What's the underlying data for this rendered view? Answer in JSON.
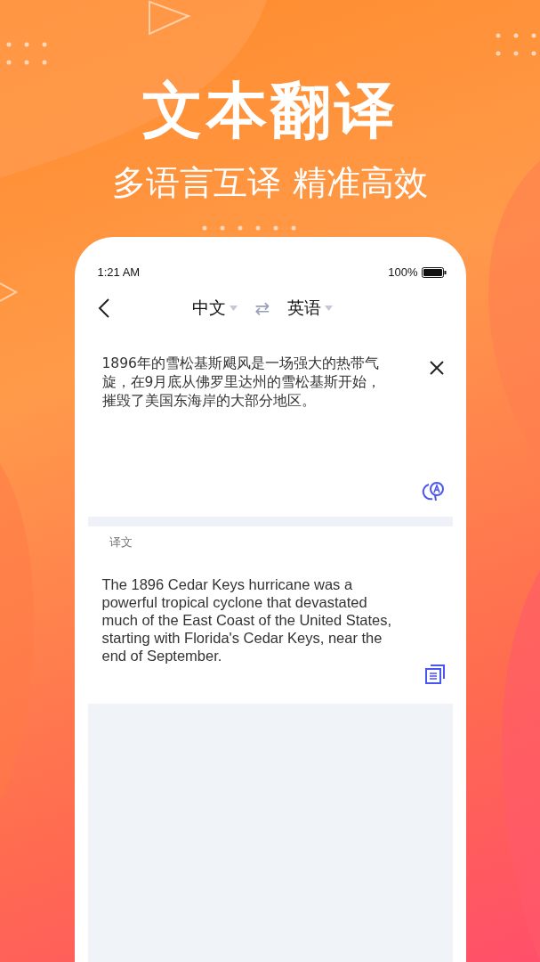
{
  "headline": "文本翻译",
  "subtitle": "多语言互译 精准高效",
  "status_bar": {
    "time": "1:21 AM",
    "battery": "100%"
  },
  "nav": {
    "source_language": "中文",
    "target_language": "英语",
    "swap_icon": "⇄"
  },
  "source": {
    "text": "1896年的雪松基斯飓风是一场强大的热带气旋，在9月底从佛罗里达州的雪松基斯开始，摧毁了美国东海岸的大部分地区。"
  },
  "result": {
    "label": "译文",
    "text": "The 1896 Cedar Keys hurricane was a powerful tropical cyclone that devastated much of the East Coast of the United States, starting with Florida's Cedar Keys, near the end of September."
  }
}
